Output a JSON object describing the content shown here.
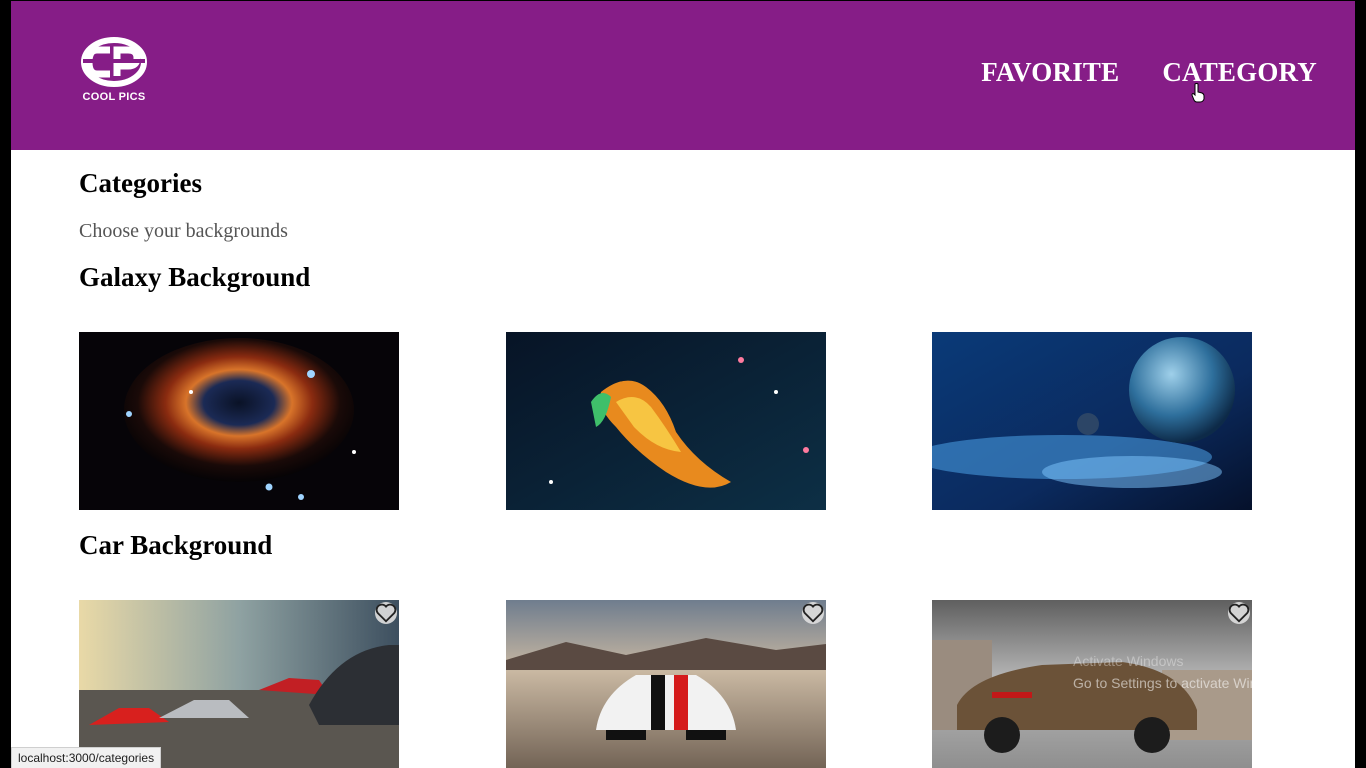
{
  "brand": {
    "logo_text": "COOL PICS"
  },
  "nav": {
    "favorite": "FAVORITE",
    "category": "CATEGORY"
  },
  "page": {
    "title": "Categories",
    "subtitle": "Choose your backgrounds"
  },
  "sections": [
    {
      "title": "Galaxy Background",
      "images": [
        "helix-nebula",
        "pillar-nebula",
        "blue-planet"
      ],
      "favorite_buttons": false
    },
    {
      "title": "Car Background",
      "images": [
        "sports-cars-lineup",
        "white-viper",
        "bronze-lamborghini"
      ],
      "favorite_buttons": true
    }
  ],
  "overlay": {
    "watermark_title": "Activate Windows",
    "watermark_text": "Go to Settings to activate Windows."
  },
  "status_bar": {
    "url": "localhost:3000/categories"
  },
  "colors": {
    "header_bg": "#861d87",
    "text_muted": "#555555"
  }
}
